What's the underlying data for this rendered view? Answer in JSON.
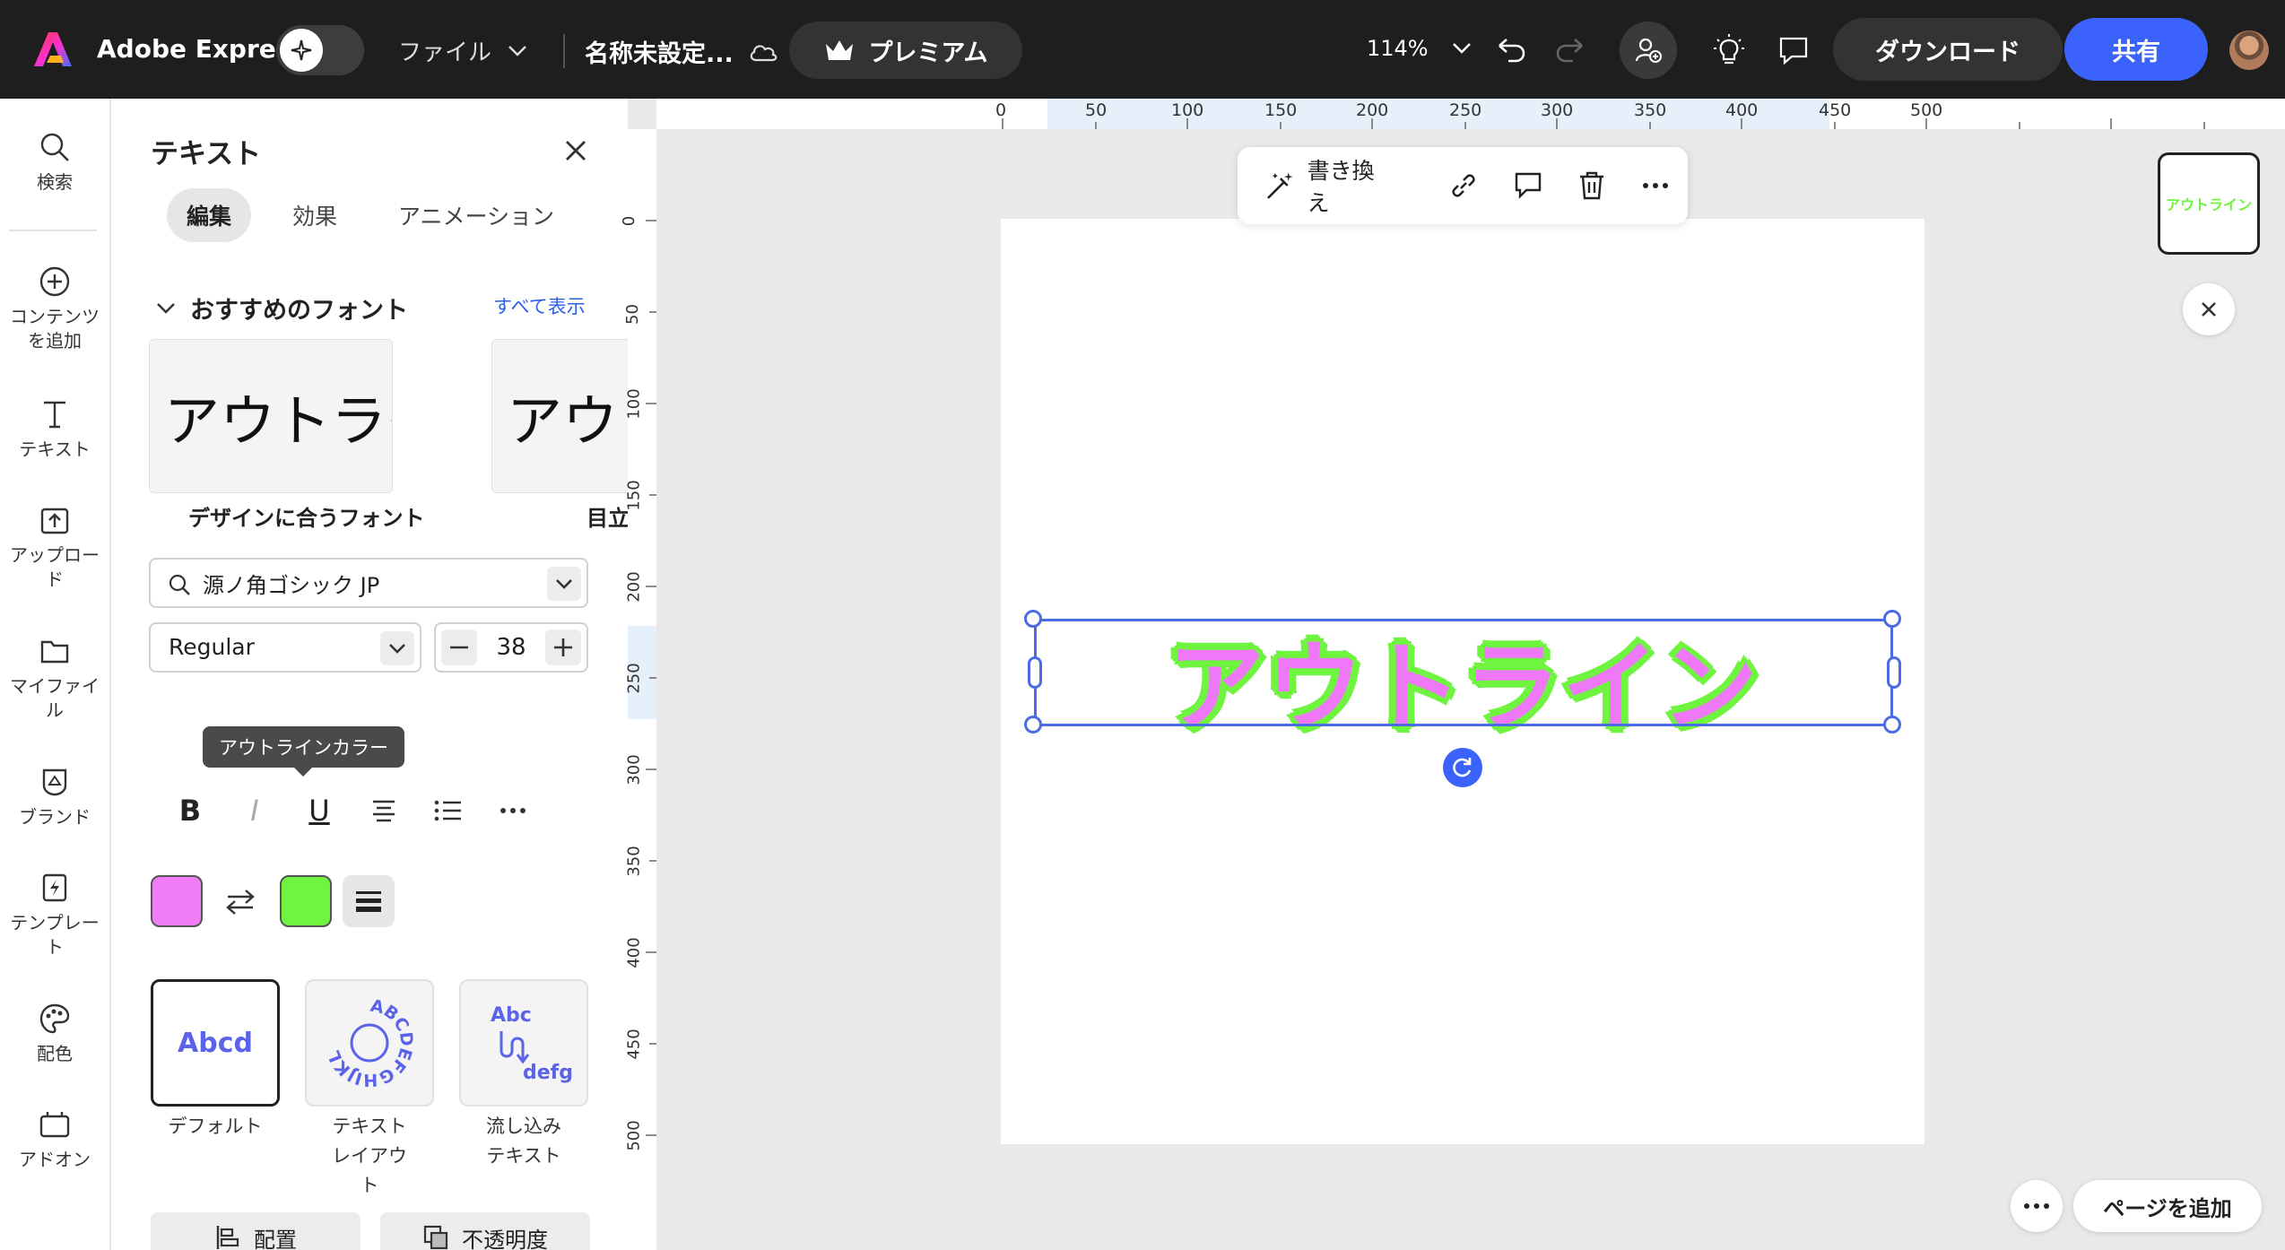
{
  "topbar": {
    "brand": "Adobe Express",
    "file_menu": "ファイル",
    "doc_name": "名称未設定...",
    "premium": "プレミアム",
    "zoom": "114%",
    "download": "ダウンロード",
    "share": "共有",
    "accent_color": "#3b63fb"
  },
  "rail": {
    "items": [
      {
        "label": "検索",
        "icon": "search-icon"
      },
      {
        "label": "コンテンツを追加",
        "icon": "plus-circle-icon"
      },
      {
        "label": "テキスト",
        "icon": "text-icon"
      },
      {
        "label": "アップロード",
        "icon": "upload-icon"
      },
      {
        "label": "マイファイル",
        "icon": "folder-icon"
      },
      {
        "label": "ブランド",
        "icon": "brand-icon"
      },
      {
        "label": "テンプレート",
        "icon": "template-icon"
      },
      {
        "label": "配色",
        "icon": "palette-icon"
      },
      {
        "label": "アドオン",
        "icon": "addon-icon"
      }
    ]
  },
  "panel": {
    "title": "テキスト",
    "tabs": [
      "編集",
      "効果",
      "アニメーション"
    ],
    "recommended_heading": "おすすめのフォント",
    "show_all": "すべて表示",
    "font_cards": [
      {
        "sample": "アウトライン",
        "caption": "デザインに合うフォント"
      },
      {
        "sample": "アウトライン",
        "caption": "目立"
      }
    ],
    "font_family": "源ノ角ゴシック JP",
    "font_weight": "Regular",
    "font_size": "38",
    "format_buttons": [
      "B",
      "I",
      "U"
    ],
    "tooltip": "アウトラインカラー",
    "fill_color": "#f07df6",
    "outline_color": "#6ff43f",
    "text_styles": [
      {
        "caption": "デフォルト",
        "sample": "Abcd"
      },
      {
        "caption": "テキストレイアウト",
        "sample": "ABCDEFGHIJKL"
      },
      {
        "caption": "流し込みテキスト",
        "sample_top": "Abc",
        "sample_bottom": "defg"
      }
    ],
    "arrange": "配置",
    "opacity": "不透明度"
  },
  "canvas": {
    "h_ruler": [
      "0",
      "50",
      "100",
      "150",
      "200",
      "250",
      "300",
      "350",
      "400",
      "450",
      "500"
    ],
    "v_ruler": [
      "0",
      "50",
      "100",
      "150",
      "200",
      "250",
      "300",
      "350",
      "400",
      "450",
      "500"
    ],
    "rewrite": "書き換え",
    "text": "アウトライン",
    "thumb_text": "アウトライン",
    "add_page": "ページを追加"
  }
}
